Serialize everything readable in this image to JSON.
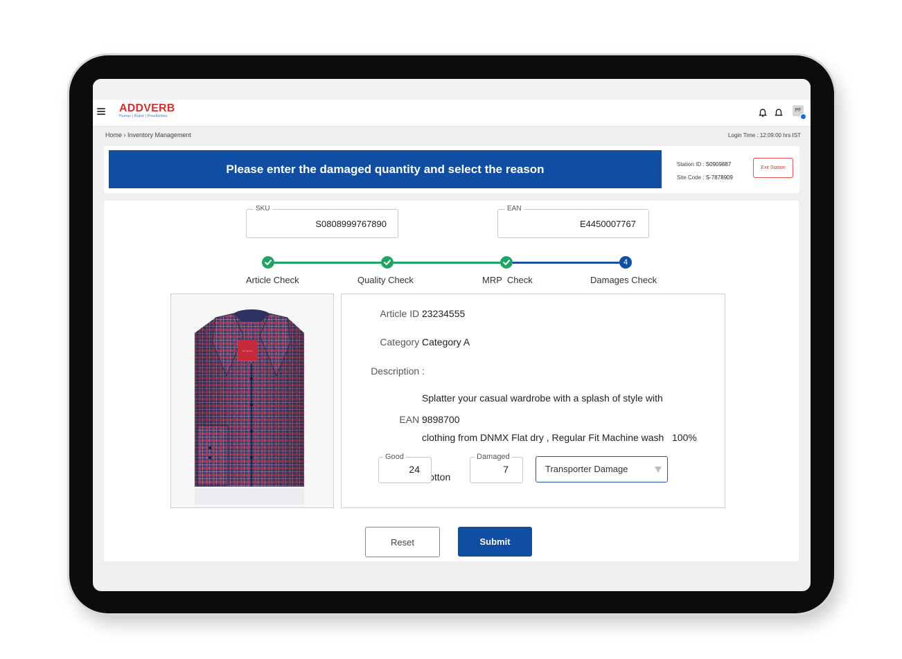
{
  "header": {
    "brand": "ADDVERB",
    "brand_tagline": "Human | Robot | Possibilities",
    "avatar_initials": "PF"
  },
  "breadcrumb": "Home › Inventory Management",
  "login_time": "Login Time : 12:09:00 hrs IST",
  "banner": {
    "message": "Please enter the damaged quantity and select the reason"
  },
  "station": {
    "station_label": "Station ID : ",
    "station_value": "S0909887",
    "site_label": "Site Code : ",
    "site_value": "S-7878909",
    "exit_label": "Exit Station"
  },
  "sku": {
    "label": "SKU",
    "value": "S0808999767890"
  },
  "ean_field": {
    "label": "EAN",
    "value": "E4450007767"
  },
  "steps": [
    {
      "label": "Article Check",
      "status": "done"
    },
    {
      "label": "Quality Check",
      "status": "done"
    },
    {
      "label": "MRP  Check",
      "status": "done"
    },
    {
      "label": "Damages Check",
      "status": "active",
      "number": "4"
    }
  ],
  "article": {
    "id_label": "Article ID :",
    "id_value": "23234555",
    "category_label": "Category :",
    "category_value": "Category A",
    "description_label": "Description :",
    "description_lines": [
      "Splatter your casual wardrobe with a splash of style with",
      "clothing from DNMX Flat dry , Regular Fit Machine wash   100%",
      "Cotton"
    ],
    "ean_label": "EAN :",
    "ean_value": "9898700"
  },
  "quantities": {
    "good_label": "Good",
    "good_value": "24",
    "damaged_label": "Damaged",
    "damaged_value": "7",
    "reason_selected": "Transporter Damage"
  },
  "actions": {
    "reset": "Reset",
    "submit": "Submit"
  },
  "colors": {
    "primary": "#0f4ea3",
    "brand_red": "#d92d2d",
    "step_done": "#1fa463"
  }
}
